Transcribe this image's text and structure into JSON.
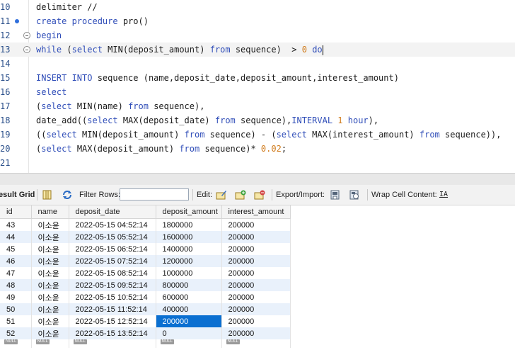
{
  "editor": {
    "lines": [
      {
        "num": "10",
        "marker": "",
        "tokens": [
          {
            "t": "delimiter //",
            "c": ""
          }
        ]
      },
      {
        "num": "11",
        "marker": "dot",
        "tokens": [
          {
            "t": "create procedure ",
            "c": "kw"
          },
          {
            "t": "pro()",
            "c": ""
          }
        ]
      },
      {
        "num": "12",
        "marker": "fold",
        "tokens": [
          {
            "t": "begin",
            "c": "kw"
          }
        ]
      },
      {
        "num": "13",
        "marker": "fold",
        "highlight": true,
        "tokens": [
          {
            "t": "while ",
            "c": "kw"
          },
          {
            "t": "(",
            "c": ""
          },
          {
            "t": "select ",
            "c": "kw"
          },
          {
            "t": "MIN",
            "c": ""
          },
          {
            "t": "(deposit_amount) ",
            "c": ""
          },
          {
            "t": "from ",
            "c": "kw"
          },
          {
            "t": "sequence)  > ",
            "c": ""
          },
          {
            "t": "0",
            "c": "num"
          },
          {
            "t": " ",
            "c": ""
          },
          {
            "t": "do",
            "c": "kw"
          }
        ]
      },
      {
        "num": "14",
        "marker": "",
        "tokens": []
      },
      {
        "num": "15",
        "marker": "",
        "tokens": [
          {
            "t": "INSERT INTO ",
            "c": "kw"
          },
          {
            "t": "sequence (name,deposit_date,deposit_amount,interest_amount)",
            "c": ""
          }
        ]
      },
      {
        "num": "16",
        "marker": "",
        "tokens": [
          {
            "t": "select",
            "c": "kw"
          }
        ]
      },
      {
        "num": "17",
        "marker": "",
        "tokens": [
          {
            "t": "(",
            "c": ""
          },
          {
            "t": "select ",
            "c": "kw"
          },
          {
            "t": "MIN(name) ",
            "c": ""
          },
          {
            "t": "from ",
            "c": "kw"
          },
          {
            "t": "sequence),",
            "c": ""
          }
        ]
      },
      {
        "num": "18",
        "marker": "",
        "tokens": [
          {
            "t": "date_add((",
            "c": ""
          },
          {
            "t": "select ",
            "c": "kw"
          },
          {
            "t": "MAX(deposit_date) ",
            "c": ""
          },
          {
            "t": "from ",
            "c": "kw"
          },
          {
            "t": "sequence),",
            "c": ""
          },
          {
            "t": "INTERVAL ",
            "c": "kw"
          },
          {
            "t": "1",
            "c": "num"
          },
          {
            "t": " ",
            "c": ""
          },
          {
            "t": "hour",
            "c": "kw"
          },
          {
            "t": "),",
            "c": ""
          }
        ]
      },
      {
        "num": "19",
        "marker": "",
        "tokens": [
          {
            "t": "((",
            "c": ""
          },
          {
            "t": "select ",
            "c": "kw"
          },
          {
            "t": "MIN(deposit_amount) ",
            "c": ""
          },
          {
            "t": "from ",
            "c": "kw"
          },
          {
            "t": "sequence) - (",
            "c": ""
          },
          {
            "t": "select ",
            "c": "kw"
          },
          {
            "t": "MAX(interest_amount) ",
            "c": ""
          },
          {
            "t": "from ",
            "c": "kw"
          },
          {
            "t": "sequence)),",
            "c": ""
          }
        ]
      },
      {
        "num": "20",
        "marker": "",
        "tokens": [
          {
            "t": "(",
            "c": ""
          },
          {
            "t": "select ",
            "c": "kw"
          },
          {
            "t": "MAX(deposit_amount) ",
            "c": ""
          },
          {
            "t": "from ",
            "c": "kw"
          },
          {
            "t": "sequence)* ",
            "c": ""
          },
          {
            "t": "0.02",
            "c": "num"
          },
          {
            "t": ";",
            "c": ""
          }
        ]
      },
      {
        "num": "21",
        "marker": "",
        "tokens": []
      }
    ]
  },
  "toolbar": {
    "result_grid_label": "esult Grid",
    "filter_rows_label": "Filter Rows:",
    "filter_value": "",
    "edit_label": "Edit:",
    "export_label": "Export/Import:",
    "wrap_label": "Wrap Cell Content:",
    "wrap_icon_glyph": "IA"
  },
  "grid": {
    "columns": [
      "id",
      "name",
      "deposit_date",
      "deposit_amount",
      "interest_amount"
    ],
    "rows": [
      [
        "43",
        "이소윤",
        "2022-05-15 04:52:14",
        "1800000",
        "200000"
      ],
      [
        "44",
        "이소윤",
        "2022-05-15 05:52:14",
        "1600000",
        "200000"
      ],
      [
        "45",
        "이소윤",
        "2022-05-15 06:52:14",
        "1400000",
        "200000"
      ],
      [
        "46",
        "이소윤",
        "2022-05-15 07:52:14",
        "1200000",
        "200000"
      ],
      [
        "47",
        "이소윤",
        "2022-05-15 08:52:14",
        "1000000",
        "200000"
      ],
      [
        "48",
        "이소윤",
        "2022-05-15 09:52:14",
        "800000",
        "200000"
      ],
      [
        "49",
        "이소윤",
        "2022-05-15 10:52:14",
        "600000",
        "200000"
      ],
      [
        "50",
        "이소윤",
        "2022-05-15 11:52:14",
        "400000",
        "200000"
      ],
      [
        "51",
        "이소윤",
        "2022-05-15 12:52:14",
        "200000",
        "200000"
      ],
      [
        "52",
        "이소윤",
        "2022-05-15 13:52:14",
        "0",
        "200000"
      ]
    ],
    "selected_cell": {
      "row": 8,
      "col": 3
    },
    "null_label": "NULL"
  },
  "colors": {
    "keyword": "#2f4db8",
    "number": "#d07a1a",
    "selection": "#0a6fd1",
    "alt_row": "#e9f1fb"
  }
}
